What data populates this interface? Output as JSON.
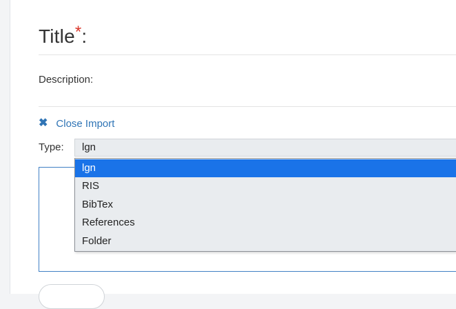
{
  "form": {
    "title_label": "Title",
    "title_required_marker": "*",
    "title_suffix": ":",
    "description_label": "Description:"
  },
  "import": {
    "close_label": "Close Import",
    "close_icon": "close-icon",
    "type_label": "Type:",
    "type_selected": "lgn",
    "type_options": [
      "lgn",
      "RIS",
      "BibTex",
      "References",
      "Folder"
    ],
    "highlighted_index": 0
  },
  "colors": {
    "required_star": "#d9372b",
    "link": "#2f74b5",
    "selection": "#1a73e8",
    "import_border": "#3f7fc4"
  }
}
